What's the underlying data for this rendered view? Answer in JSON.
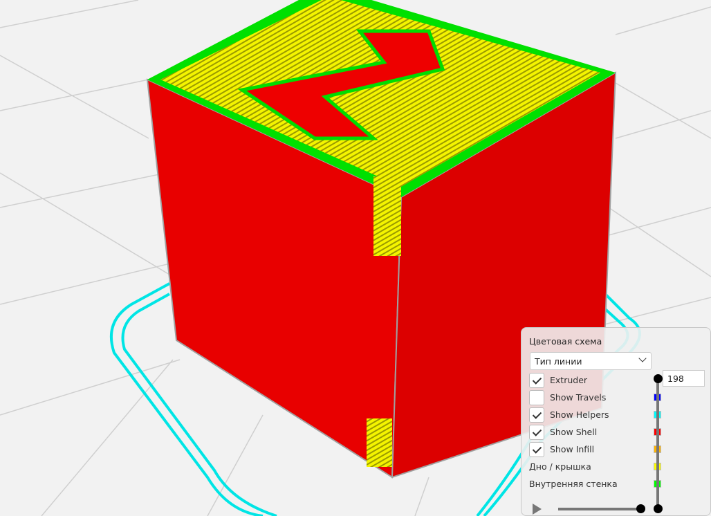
{
  "panel": {
    "title": "Цветовая схема",
    "color_scheme_selected": "Тип линии",
    "layer_number": "198",
    "options": [
      {
        "label": "Extruder",
        "checked": true
      },
      {
        "label": "Show Travels",
        "checked": false,
        "color": "#0000ff"
      },
      {
        "label": "Show Helpers",
        "checked": true,
        "color": "#00ffff"
      },
      {
        "label": "Show Shell",
        "checked": true,
        "color": "#ff0000"
      },
      {
        "label": "Show Infill",
        "checked": true,
        "color": "#ffb400"
      }
    ],
    "legend": [
      {
        "label": "Дно / крышка",
        "color": "#ffff00"
      },
      {
        "label": "Внутренняя стенка",
        "color": "#00ff00"
      }
    ],
    "layer_slider_fraction": 1.0,
    "simulation_slider_fraction": 1.0
  }
}
